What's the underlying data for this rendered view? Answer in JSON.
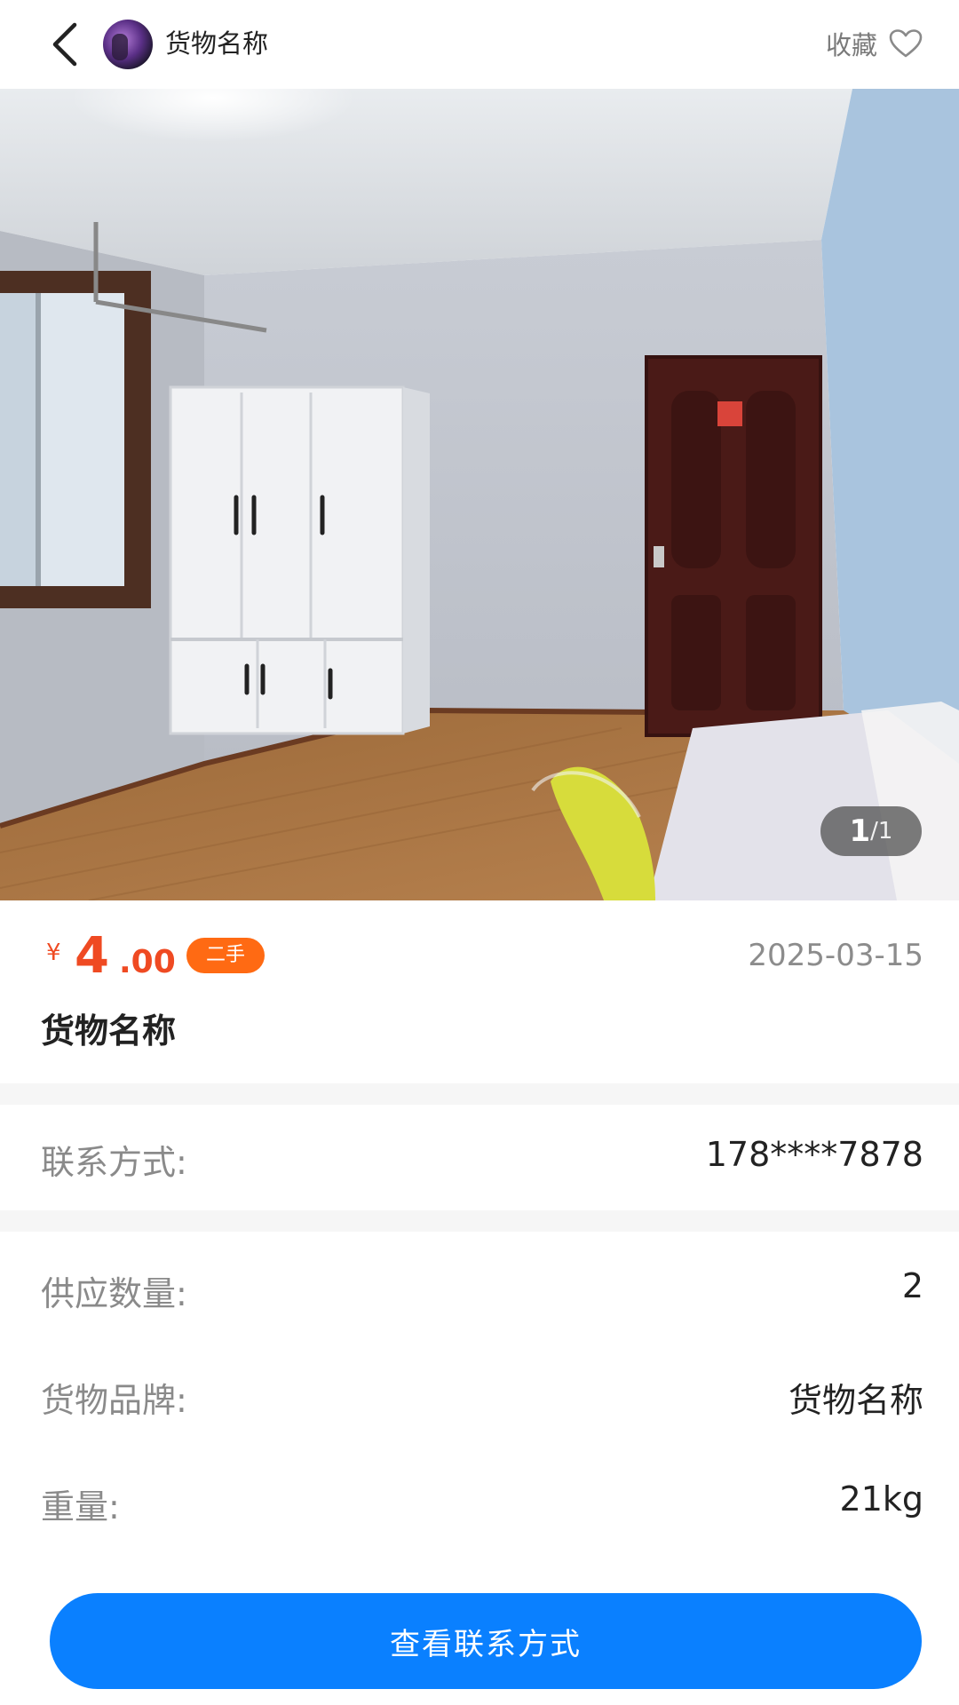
{
  "header": {
    "title": "货物名称",
    "favorite_label": "收藏"
  },
  "gallery": {
    "current": "1",
    "total": "/1"
  },
  "product": {
    "currency": "¥",
    "price_int": "4",
    "price_dec": ".00",
    "badge": "二手",
    "date": "2025-03-15",
    "name": "货物名称"
  },
  "contact": {
    "label": "联系方式:",
    "value": "178****7878"
  },
  "details": [
    {
      "label": "供应数量:",
      "value": "2"
    },
    {
      "label": "货物品牌:",
      "value": "货物名称"
    },
    {
      "label": "重量:",
      "value": "21kg"
    }
  ],
  "cta": {
    "label": "查看联系方式"
  },
  "colors": {
    "price": "#ef4a22",
    "badge": "#ff6a13",
    "cta": "#0a80ff"
  }
}
